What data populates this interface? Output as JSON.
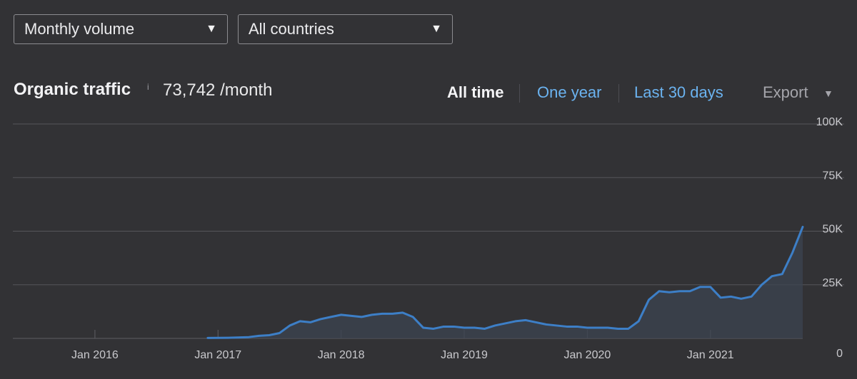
{
  "filters": {
    "volume": {
      "label": "Monthly volume",
      "caret_icon": "caret-down-icon"
    },
    "country": {
      "label": "All countries",
      "caret_icon": "caret-down-icon"
    }
  },
  "header": {
    "title": "Organic traffic",
    "info_symbol": "i",
    "value_text": "73,742 /month"
  },
  "range_tabs": [
    {
      "label": "All time",
      "active": true
    },
    {
      "label": "One year",
      "active": false
    },
    {
      "label": "Last 30 days",
      "active": false
    }
  ],
  "export": {
    "label": "Export",
    "caret_icon": "caret-down-icon"
  },
  "colors": {
    "background": "#323235",
    "line": "#3d7fc7",
    "area": "#3c4450",
    "grid": "#55555a",
    "link": "#6bb3f0"
  },
  "chart_data": {
    "type": "area",
    "title": "Organic traffic",
    "x_ticks": [
      "Jan 2016",
      "Jan 2017",
      "Jan 2018",
      "Jan 2019",
      "Jan 2020",
      "Jan 2021"
    ],
    "y_ticks": [
      "100K",
      "75K",
      "50K",
      "25K",
      "0"
    ],
    "ylim": [
      0,
      100000
    ],
    "xlim": [
      "2015-05",
      "2021-10"
    ],
    "grid": true,
    "series": [
      {
        "x": [
          "2016-12",
          "2017-02",
          "2017-04",
          "2017-05",
          "2017-06",
          "2017-07",
          "2017-08",
          "2017-09",
          "2017-10",
          "2017-11",
          "2017-12",
          "2018-01",
          "2018-02",
          "2018-03",
          "2018-04",
          "2018-05",
          "2018-06",
          "2018-07",
          "2018-08",
          "2018-09",
          "2018-10",
          "2018-11",
          "2018-12",
          "2019-01",
          "2019-02",
          "2019-03",
          "2019-04",
          "2019-05",
          "2019-06",
          "2019-07",
          "2019-08",
          "2019-09",
          "2019-10",
          "2019-11",
          "2019-12",
          "2020-01",
          "2020-02",
          "2020-03",
          "2020-04",
          "2020-05",
          "2020-06",
          "2020-07",
          "2020-08",
          "2020-09",
          "2020-10",
          "2020-11",
          "2020-12",
          "2021-01",
          "2021-02",
          "2021-03",
          "2021-04",
          "2021-05",
          "2021-06",
          "2021-07",
          "2021-08",
          "2021-09",
          "2021-10"
        ],
        "values": [
          200,
          300,
          600,
          1200,
          1500,
          2500,
          6000,
          8000,
          7500,
          9000,
          10000,
          11000,
          10500,
          10000,
          11000,
          11500,
          11500,
          12000,
          10000,
          5000,
          4500,
          5500,
          5500,
          5000,
          5000,
          4500,
          6000,
          7000,
          8000,
          8500,
          7500,
          6500,
          6000,
          5500,
          5500,
          5000,
          5000,
          5000,
          4500,
          4500,
          8000,
          18000,
          22000,
          21500,
          22000,
          22000,
          24000,
          24000,
          19000,
          19500,
          18500,
          19500,
          25000,
          29000,
          30000,
          40000,
          52000
        ]
      }
    ]
  }
}
